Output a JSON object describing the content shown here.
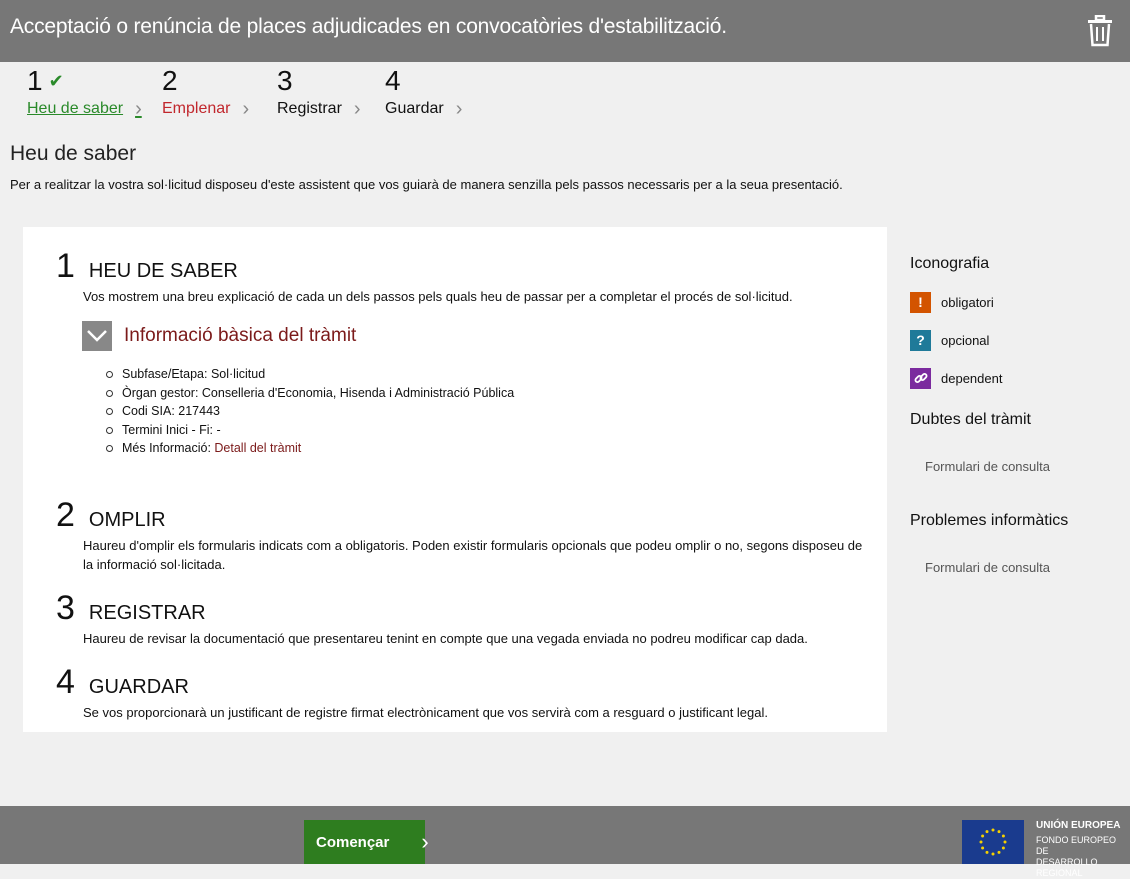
{
  "window": {
    "title": "Acceptació o renúncia de places adjudicades en convocatòries d'estabilització."
  },
  "steps": [
    {
      "num": "1",
      "label": "Heu de saber",
      "state": "done"
    },
    {
      "num": "2",
      "label": "Emplenar",
      "state": "active"
    },
    {
      "num": "3",
      "label": "Registrar",
      "state": "pending"
    },
    {
      "num": "4",
      "label": "Guardar",
      "state": "pending"
    }
  ],
  "page": {
    "title": "Heu de saber",
    "intro": "Per a realitzar la vostra sol·licitud disposeu d'este assistent que vos guiarà de manera senzilla pels passos necessaris per a la seua presentació."
  },
  "sections": [
    {
      "num": "1",
      "title": "HEU DE SABER",
      "desc": "Vos mostrem una breu explicació de cada un dels passos pels quals heu de passar per a completar el procés de sol·licitud."
    },
    {
      "num": "2",
      "title": "OMPLIR",
      "desc": "Haureu d'omplir els formularis indicats com a obligatoris. Poden existir formularis opcionals que podeu omplir o no, segons disposeu de la informació sol·licitada."
    },
    {
      "num": "3",
      "title": "REGISTRAR",
      "desc": "Haureu de revisar la documentació que presentareu tenint en compte que una vegada enviada no podreu modificar cap dada."
    },
    {
      "num": "4",
      "title": "GUARDAR",
      "desc": "Se vos proporcionarà un justificant de registre firmat electrònicament que vos servirà com a resguard o justificant legal."
    }
  ],
  "info": {
    "toggle_label": "Informació bàsica del tràmit",
    "items": [
      "Subfase/Etapa: Sol·licitud",
      "Òrgan gestor: Conselleria d'Economia, Hisenda i Administració Pública",
      "Codi SIA: 217443",
      "Termini Inici - Fi: -"
    ],
    "more_label": "Més Informació: ",
    "more_link": "Detall del tràmit"
  },
  "sidebar": {
    "iconography_title": "Iconografia",
    "legend": [
      {
        "icon": "exclamation-icon",
        "glyph": "!",
        "color": "#d35400",
        "label": "obligatori"
      },
      {
        "icon": "question-icon",
        "glyph": "?",
        "color": "#1f7a99",
        "label": "opcional"
      },
      {
        "icon": "link-icon",
        "glyph": "",
        "color": "#7b2a9e",
        "label": "dependent"
      }
    ],
    "doubts_title": "Dubtes del tràmit",
    "doubts_link": "Formulari de consulta",
    "problems_title": "Problemes informàtics",
    "problems_link": "Formulari de consulta"
  },
  "footer": {
    "start_label": "Començar",
    "eu_title": "UNIÓN EUROPEA",
    "eu_line1": "FONDO EUROPEO DE",
    "eu_line2": "DESARROLLO REGIONAL"
  },
  "colors": {
    "bar": "#777777",
    "done": "#2a8a2a",
    "active": "#c1272d",
    "link": "#7b1a1a",
    "start": "#2e7d1f"
  }
}
